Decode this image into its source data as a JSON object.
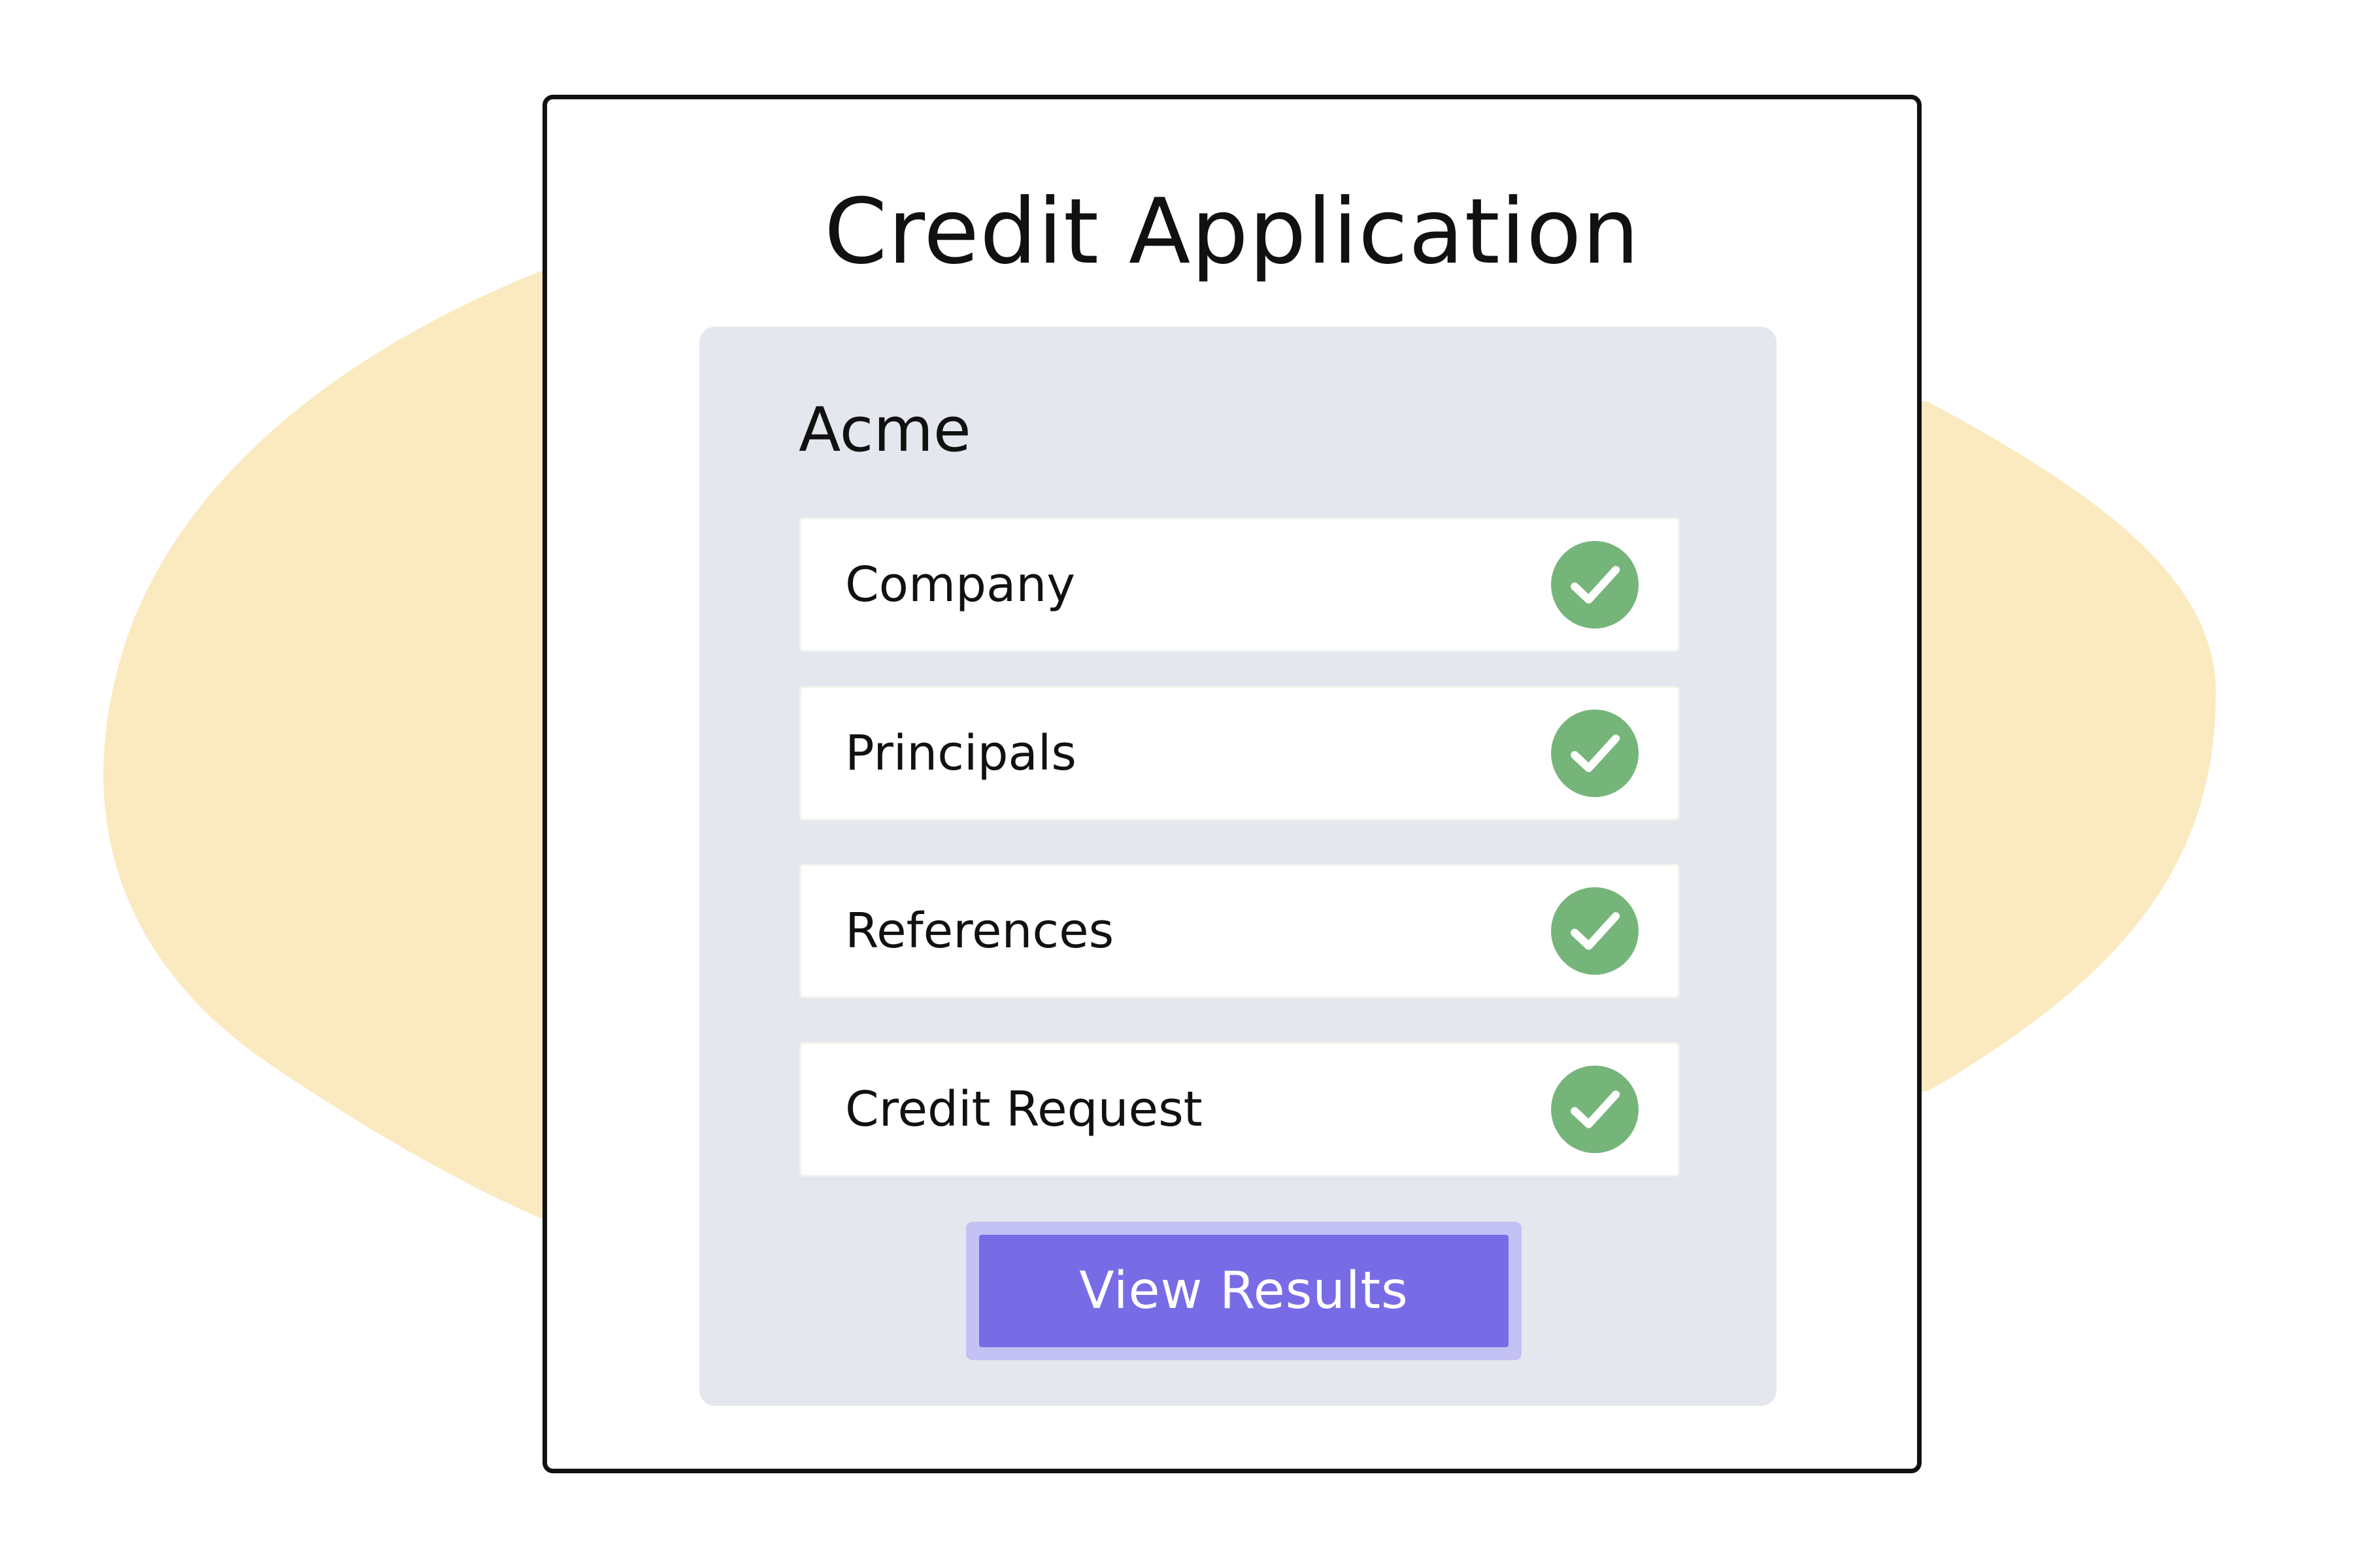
{
  "colors": {
    "background_blob": "#fbe9c0",
    "panel_bg": "#e4e8ee",
    "check_green": "#76b57a",
    "button_bg": "#786ce6",
    "button_halo": "#c4c1f4",
    "card_border": "#111111"
  },
  "title": "Credit Application",
  "company": "Acme",
  "sections": [
    {
      "label": "Company",
      "status_icon": "check-circle-icon",
      "completed": true
    },
    {
      "label": "Principals",
      "status_icon": "check-circle-icon",
      "completed": true
    },
    {
      "label": "References",
      "status_icon": "check-circle-icon",
      "completed": true
    },
    {
      "label": "Credit Request",
      "status_icon": "check-circle-icon",
      "completed": true
    }
  ],
  "action": {
    "label": "View Results"
  }
}
